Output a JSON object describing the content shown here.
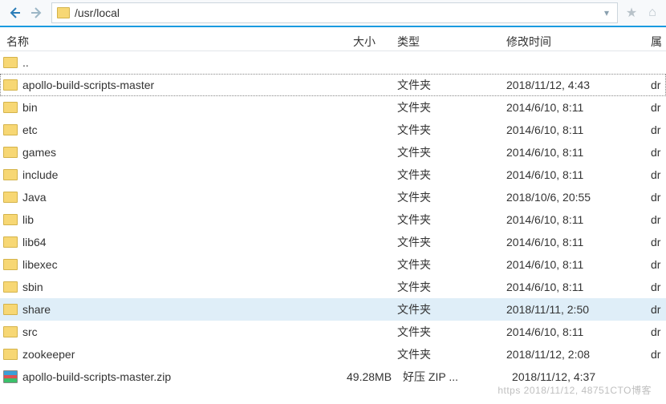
{
  "address": {
    "path": "/usr/local"
  },
  "columns": {
    "name": "名称",
    "size": "大小",
    "type": "类型",
    "mtime": "修改时间",
    "attr": "属"
  },
  "rows": [
    {
      "icon": "folder-up",
      "name": "..",
      "size": "",
      "type": "",
      "mtime": "",
      "attr": "",
      "state": ""
    },
    {
      "icon": "folder",
      "name": "apollo-build-scripts-master",
      "size": "",
      "type": "文件夹",
      "mtime": "2018/11/12, 4:43",
      "attr": "dr",
      "state": "selected"
    },
    {
      "icon": "folder",
      "name": "bin",
      "size": "",
      "type": "文件夹",
      "mtime": "2014/6/10, 8:11",
      "attr": "dr",
      "state": ""
    },
    {
      "icon": "folder",
      "name": "etc",
      "size": "",
      "type": "文件夹",
      "mtime": "2014/6/10, 8:11",
      "attr": "dr",
      "state": ""
    },
    {
      "icon": "folder",
      "name": "games",
      "size": "",
      "type": "文件夹",
      "mtime": "2014/6/10, 8:11",
      "attr": "dr",
      "state": ""
    },
    {
      "icon": "folder",
      "name": "include",
      "size": "",
      "type": "文件夹",
      "mtime": "2014/6/10, 8:11",
      "attr": "dr",
      "state": ""
    },
    {
      "icon": "folder",
      "name": "Java",
      "size": "",
      "type": "文件夹",
      "mtime": "2018/10/6, 20:55",
      "attr": "dr",
      "state": ""
    },
    {
      "icon": "folder",
      "name": "lib",
      "size": "",
      "type": "文件夹",
      "mtime": "2014/6/10, 8:11",
      "attr": "dr",
      "state": ""
    },
    {
      "icon": "folder",
      "name": "lib64",
      "size": "",
      "type": "文件夹",
      "mtime": "2014/6/10, 8:11",
      "attr": "dr",
      "state": ""
    },
    {
      "icon": "folder",
      "name": "libexec",
      "size": "",
      "type": "文件夹",
      "mtime": "2014/6/10, 8:11",
      "attr": "dr",
      "state": ""
    },
    {
      "icon": "folder",
      "name": "sbin",
      "size": "",
      "type": "文件夹",
      "mtime": "2014/6/10, 8:11",
      "attr": "dr",
      "state": ""
    },
    {
      "icon": "folder",
      "name": "share",
      "size": "",
      "type": "文件夹",
      "mtime": "2018/11/11, 2:50",
      "attr": "dr",
      "state": "highlight"
    },
    {
      "icon": "folder",
      "name": "src",
      "size": "",
      "type": "文件夹",
      "mtime": "2014/6/10, 8:11",
      "attr": "dr",
      "state": ""
    },
    {
      "icon": "folder",
      "name": "zookeeper",
      "size": "",
      "type": "文件夹",
      "mtime": "2018/11/12, 2:08",
      "attr": "dr",
      "state": ""
    },
    {
      "icon": "zip",
      "name": "apollo-build-scripts-master.zip",
      "size": "49.28MB",
      "type": "好压 ZIP ...",
      "mtime": "2018/11/12, 4:37",
      "attr": "",
      "state": ""
    }
  ],
  "watermark": "https 2018/11/12, 48751CTO博客"
}
